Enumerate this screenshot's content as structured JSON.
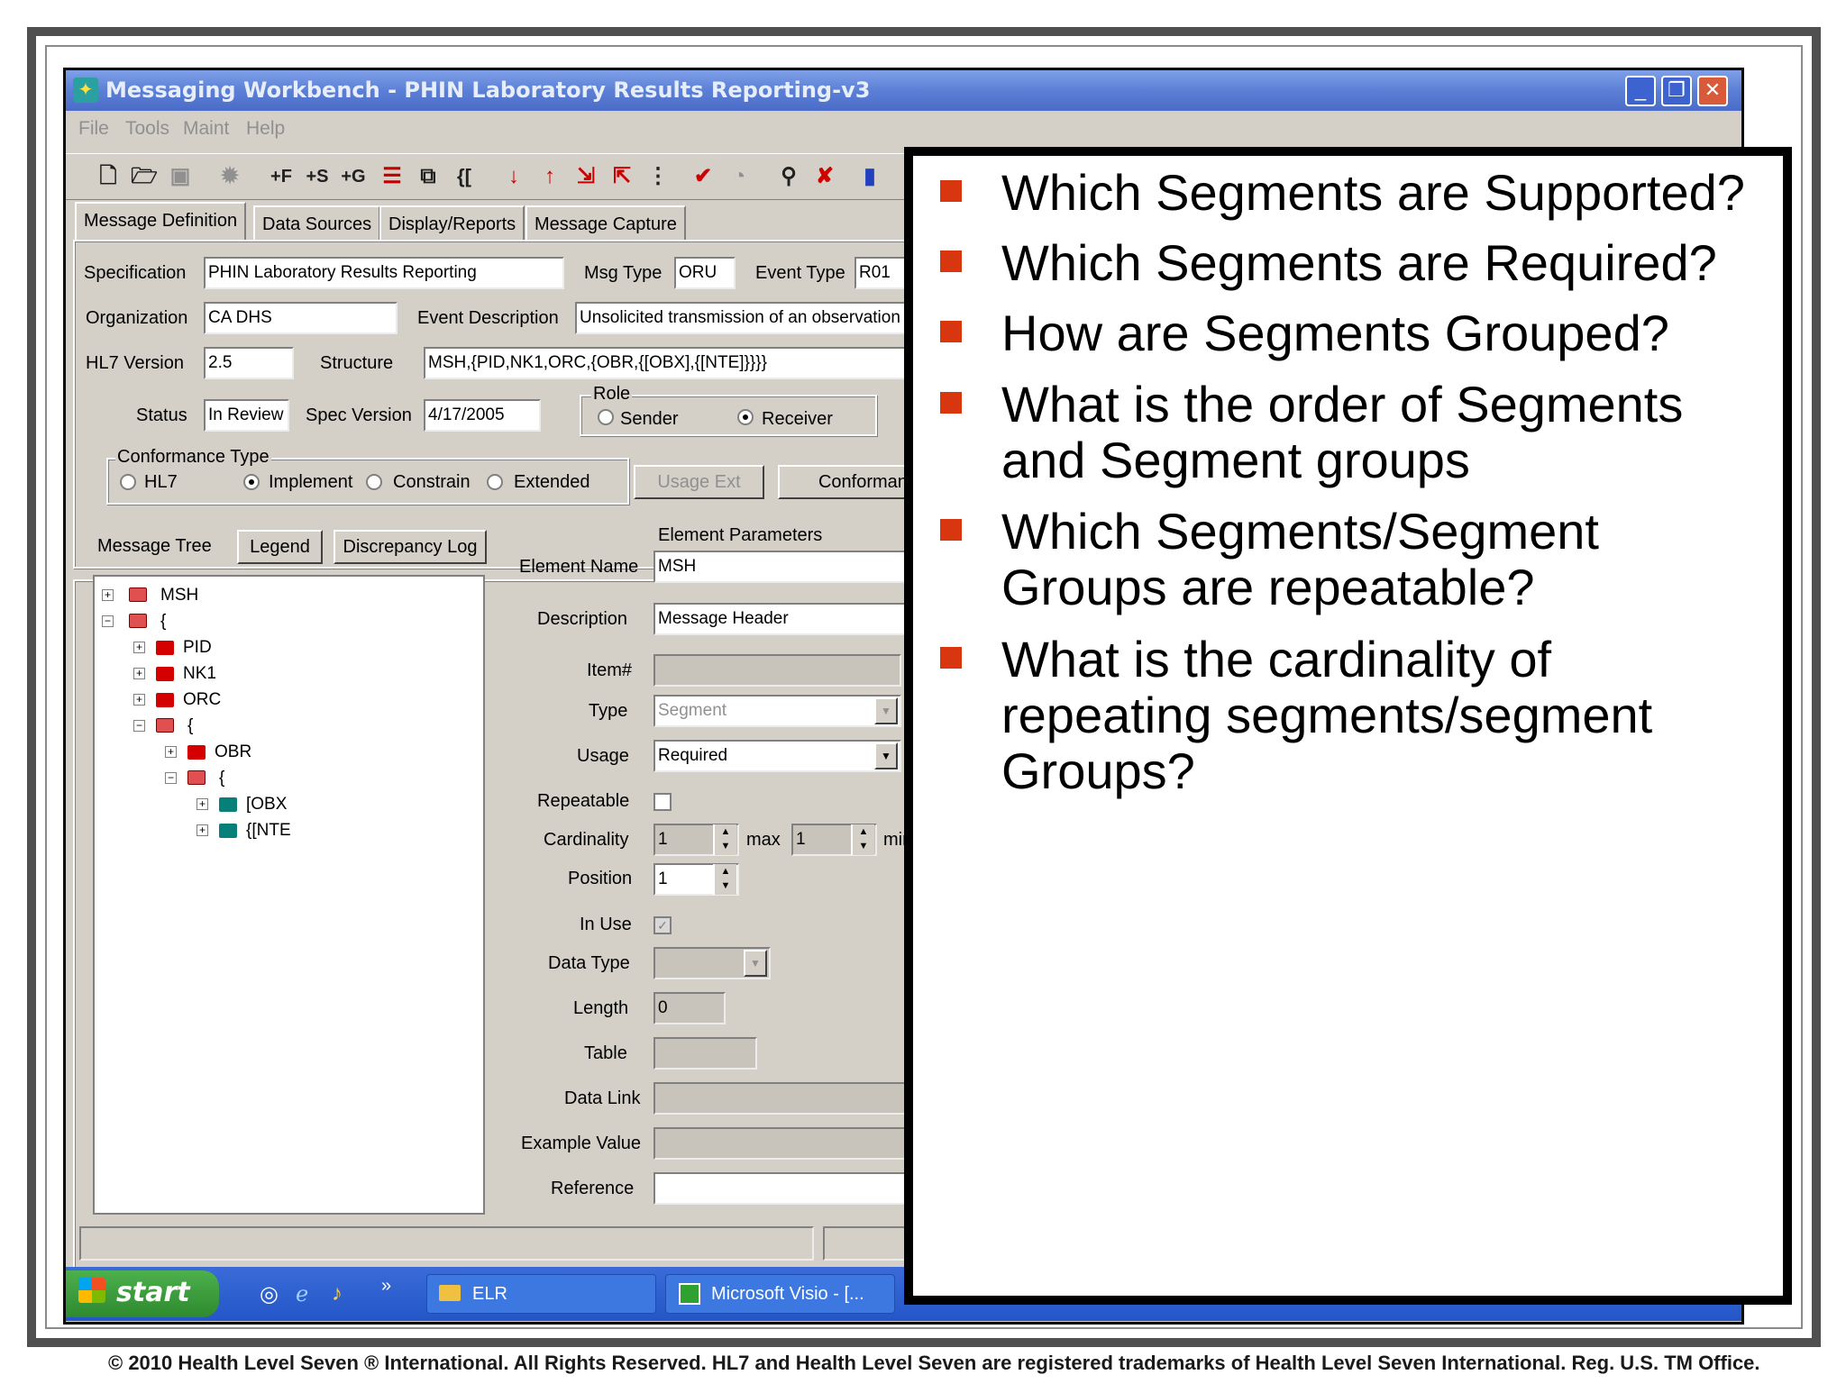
{
  "window": {
    "title": "Messaging Workbench - PHIN Laboratory Results Reporting-v3",
    "controls": {
      "minimize": "_",
      "restore": "❐",
      "close": "✕"
    }
  },
  "menu": [
    "File",
    "Tools",
    "Maint",
    "Help"
  ],
  "toolbar": {
    "add_f": "+F",
    "add_s": "+S",
    "add_g": "+G",
    "brace": "{[",
    "icons": [
      "new-icon",
      "open-icon",
      "save-icon",
      "gear-icon",
      "move-down-icon",
      "move-up-icon",
      "check-icon",
      "link-icon",
      "delete-icon",
      "chart-icon"
    ]
  },
  "tabs": [
    "Message Definition",
    "Data Sources",
    "Display/Reports",
    "Message Capture"
  ],
  "definition": {
    "spec_label": "Specification",
    "spec_value": "PHIN Laboratory Results Reporting",
    "msgtype_label": "Msg Type",
    "msgtype_value": "ORU",
    "event_label": "Event Type",
    "event_value": "R01",
    "org_label": "Organization",
    "org_value": "CA DHS",
    "event_desc_label": "Event Description",
    "event_desc_value": "Unsolicited transmission of an observation",
    "hl7_label": "HL7 Version",
    "hl7_value": "2.5",
    "structure_label": "Structure",
    "structure_value": "MSH,{PID,NK1,ORC,{OBR,{[OBX],{[NTE]}}}}",
    "status_label": "Status",
    "status_value": "In Review",
    "specver_label": "Spec Version",
    "specver_value": "4/17/2005",
    "role_label": "Role",
    "role_sender": "Sender",
    "role_receiver": "Receiver",
    "conf_label": "Conformance Type",
    "conf_hl7": "HL7",
    "conf_implement": "Implement",
    "conf_constrain": "Constrain",
    "conf_extended": "Extended",
    "usage_ext_button": "Usage Ext",
    "conformance_button": "Conformance"
  },
  "tree": {
    "title": "Message Tree",
    "legend_button": "Legend",
    "discrepancy_button": "Discrepancy Log",
    "nodes": [
      "MSH",
      "{",
      "PID",
      "NK1",
      "ORC",
      "{",
      "OBR",
      "{",
      "[OBX",
      "{[NTE"
    ]
  },
  "element": {
    "section_title": "Element Parameters",
    "name_label": "Element Name",
    "name_value": "MSH",
    "desc_label": "Description",
    "desc_value": "Message Header",
    "item_label": "Item#",
    "type_label": "Type",
    "type_value": "Segment",
    "usage_label": "Usage",
    "usage_value": "Required",
    "repeatable_label": "Repeatable",
    "cardinality_label": "Cardinality",
    "card_min": "1",
    "max_label": "max",
    "card_max": "1",
    "min_label": "min",
    "position_label": "Position",
    "position_value": "1",
    "inuse_label": "In Use",
    "inuse_check": "✓",
    "datatype_label": "Data Type",
    "length_label": "Length",
    "length_value": "0",
    "table_label": "Table",
    "datalink_label": "Data Link",
    "example_label": "Example Value",
    "reference_label": "Reference"
  },
  "taskbar": {
    "start": "start",
    "more": "»",
    "items": [
      "ELR",
      "Microsoft Visio - [..."
    ]
  },
  "overlay": {
    "bullets": [
      "Which Segments are Supported?",
      "Which Segments are Required?",
      "How are Segments Grouped?",
      "What is the order of Segments and Segment groups",
      "Which Segments/Segment Groups are repeatable?",
      "What is the cardinality of repeating segments/segment Groups?"
    ],
    "bullet_color": "#d8360e"
  },
  "footer": {
    "copyright": "© 2010 Health Level Seven ® International. All Rights Reserved. HL7 and Health Level Seven are registered trademarks of Health Level Seven International. Reg. U.S. TM Office."
  }
}
